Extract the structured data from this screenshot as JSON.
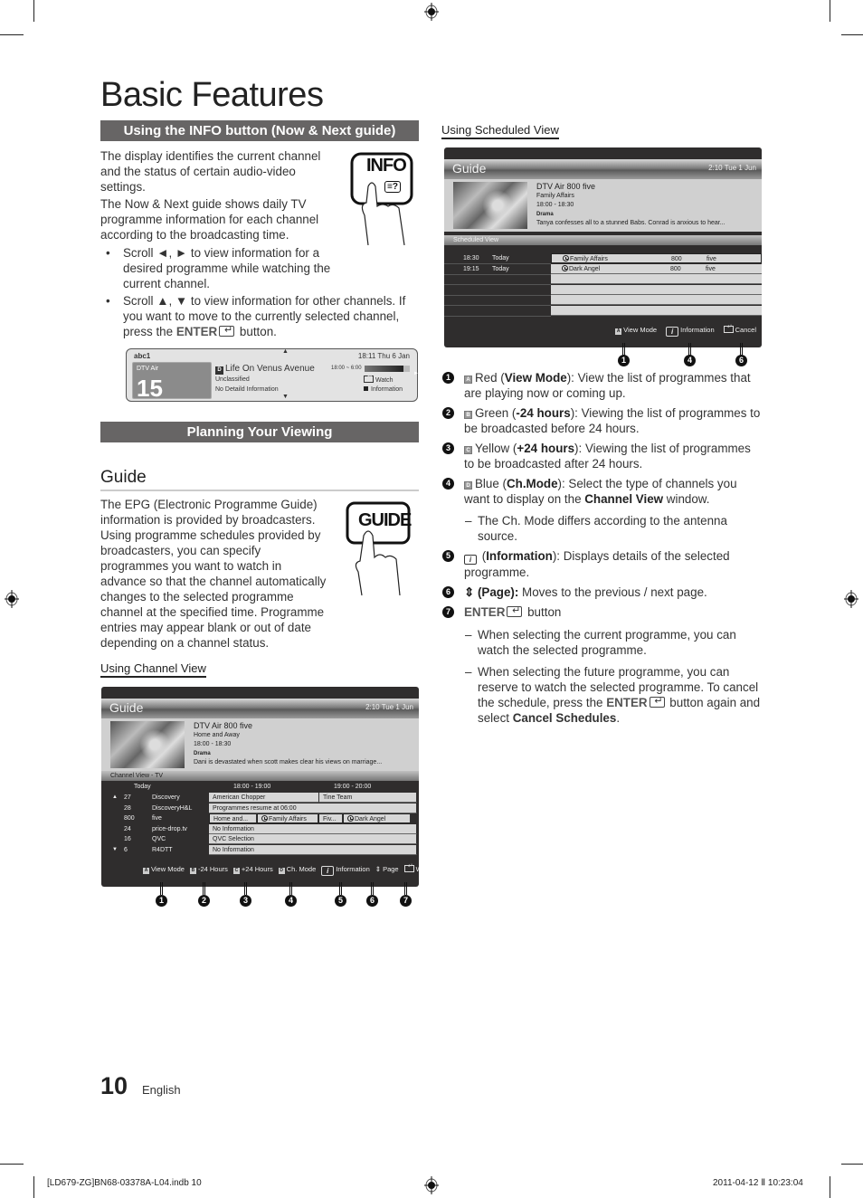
{
  "page": {
    "title": "Basic Features",
    "page_number": "10",
    "language": "English",
    "slug_left": "[LD679-ZG]BN68-03378A-L04.indb   10",
    "slug_right": "2011-04-12   Ⅱ 10:23:04"
  },
  "info_section": {
    "heading": "Using the INFO button (Now & Next guide)",
    "para1": "The display identifies the current channel and the status of certain audio-video settings.",
    "para2": "The Now & Next guide shows daily TV programme information for each channel according to the broadcasting time.",
    "bullet1": "Scroll ◄, ► to view information for a desired programme while watching the current channel.",
    "bullet2_pre": "Scroll ▲, ▼ to view information for other channels. If you want to move to the currently selected channel, press the ",
    "bullet2_enter": "ENTER",
    "bullet2_post": " button.",
    "remote_label": "INFO",
    "remote_sub": "≡?",
    "banner": {
      "channel_name": "abc1",
      "datetime": "18:11 Thu 6 Jan",
      "source": "DTV Air",
      "channel_number": "15",
      "badge": "D",
      "programme": "Life On Venus Avenue",
      "rating": "Unclassified",
      "detail": "No Detaild Information",
      "time_range": "18:00 ~ 6:00",
      "progress": 0.85,
      "watch_label": "Watch",
      "info_label": "Information"
    }
  },
  "planning_section": {
    "heading": "Planning Your Viewing",
    "guide_heading": "Guide",
    "guide_para": "The EPG (Electronic Programme Guide) information is provided by broadcasters. Using programme schedules provided by broadcasters, you can specify programmes you want to watch in advance so that the channel automatically changes to the selected programme channel at the specified time. Programme entries may appear blank or out of date depending on a channel status.",
    "remote_label": "GUIDE",
    "channel_view_heading": "Using  Channel View"
  },
  "channel_view": {
    "title": "Guide",
    "datetime": "2:10 Tue 1 Jun",
    "preview": {
      "channel": "DTV Air 800 five",
      "programme": "Home and Away",
      "time": "18:00 - 18:30",
      "genre": "Drama",
      "synopsis": "Dani is devastated when scott makes clear his views on marriage..."
    },
    "subbar": "Channel View - TV",
    "columns": [
      "Today",
      "18:00 - 19:00",
      "19:00 - 20:00"
    ],
    "rows": [
      {
        "arrow": "▲",
        "num": "27",
        "name": "Discovery",
        "progs": [
          "American Chopper",
          "Tine Team"
        ]
      },
      {
        "arrow": "",
        "num": "28",
        "name": "DiscoveryH&L",
        "progs": [
          "Programmes resume at 06:00"
        ]
      },
      {
        "arrow": "",
        "num": "800",
        "name": "five",
        "progs": [
          "Home and...",
          "Family Affairs",
          "Fiv...",
          "Dark Angel"
        ]
      },
      {
        "arrow": "",
        "num": "24",
        "name": "price-drop.tv",
        "progs": [
          "No Information"
        ]
      },
      {
        "arrow": "",
        "num": "16",
        "name": "QVC",
        "progs": [
          "QVC Selection"
        ]
      },
      {
        "arrow": "▼",
        "num": "6",
        "name": "R4DTT",
        "progs": [
          "No Information"
        ]
      }
    ],
    "footer": [
      {
        "key": "A",
        "label": "View Mode"
      },
      {
        "key": "B",
        "label": "-24 Hours"
      },
      {
        "key": "C",
        "label": "+24 Hours"
      },
      {
        "key": "D",
        "label": "Ch. Mode"
      },
      {
        "key": "i",
        "label": "Information"
      },
      {
        "key": "⇕",
        "label": "Page"
      },
      {
        "key": "↵",
        "label": "Watch"
      }
    ],
    "callouts": [
      "1",
      "2",
      "3",
      "4",
      "5",
      "6",
      "7"
    ]
  },
  "scheduled_view": {
    "heading": "Using Scheduled View",
    "title": "Guide",
    "datetime": "2:10 Tue 1 Jun",
    "preview": {
      "channel": "DTV Air 800 five",
      "programme": "Family Affairs",
      "time": "18:00 - 18:30",
      "genre": "Drama",
      "synopsis": "Tanya confesses all to a stunned Babs. Conrad is anxious to hear..."
    },
    "subbar": "Scheduled View",
    "rows": [
      {
        "time": "18:30",
        "day": "Today",
        "programme": "Family Affairs",
        "num": "800",
        "channel": "five"
      },
      {
        "time": "19:15",
        "day": "Today",
        "programme": "Dark Angel",
        "num": "800",
        "channel": "five"
      }
    ],
    "footer": [
      {
        "key": "A",
        "label": "View Mode"
      },
      {
        "key": "i",
        "label": "Information"
      },
      {
        "key": "↵",
        "label": "Cancel"
      }
    ],
    "callouts": [
      "1",
      "4",
      "6"
    ]
  },
  "descriptions": {
    "d1": {
      "num": "1",
      "key": "A",
      "pre": "Red (",
      "bold": "View Mode",
      "post": "): View the list of programmes that are playing now or coming up."
    },
    "d2": {
      "num": "2",
      "key": "B",
      "pre": "Green (",
      "bold": "-24 hours",
      "post": "): Viewing the list of programmes to be broadcasted before 24 hours."
    },
    "d3": {
      "num": "3",
      "key": "C",
      "pre": "Yellow (",
      "bold": "+24 hours",
      "post": "): Viewing the list of programmes to be broadcasted after 24 hours."
    },
    "d4": {
      "num": "4",
      "key": "D",
      "pre": "Blue (",
      "bold": "Ch.Mode",
      "post": "): Select the type of channels you want to display on the ",
      "bold2": "Channel View",
      "post2": " window."
    },
    "d4_sub": "The Ch. Mode differs according to the antenna source.",
    "d5": {
      "num": "5",
      "pre": " (",
      "bold": "Information",
      "post": "): Displays details of the selected programme."
    },
    "d6": {
      "num": "6",
      "bold": "⇕ (Page):",
      "post": " Moves to the previous / next page."
    },
    "d7": {
      "num": "7",
      "enter": "ENTER",
      "post": " button"
    },
    "d7_sub1": "When selecting the current programme, you can watch the selected programme.",
    "d7_sub2_pre": "When selecting the future programme, you can reserve to watch the selected programme. To cancel the schedule, press the ",
    "d7_sub2_enter": "ENTER",
    "d7_sub2_mid": " button again and select ",
    "d7_sub2_bold": "Cancel Schedules",
    "d7_sub2_end": "."
  }
}
